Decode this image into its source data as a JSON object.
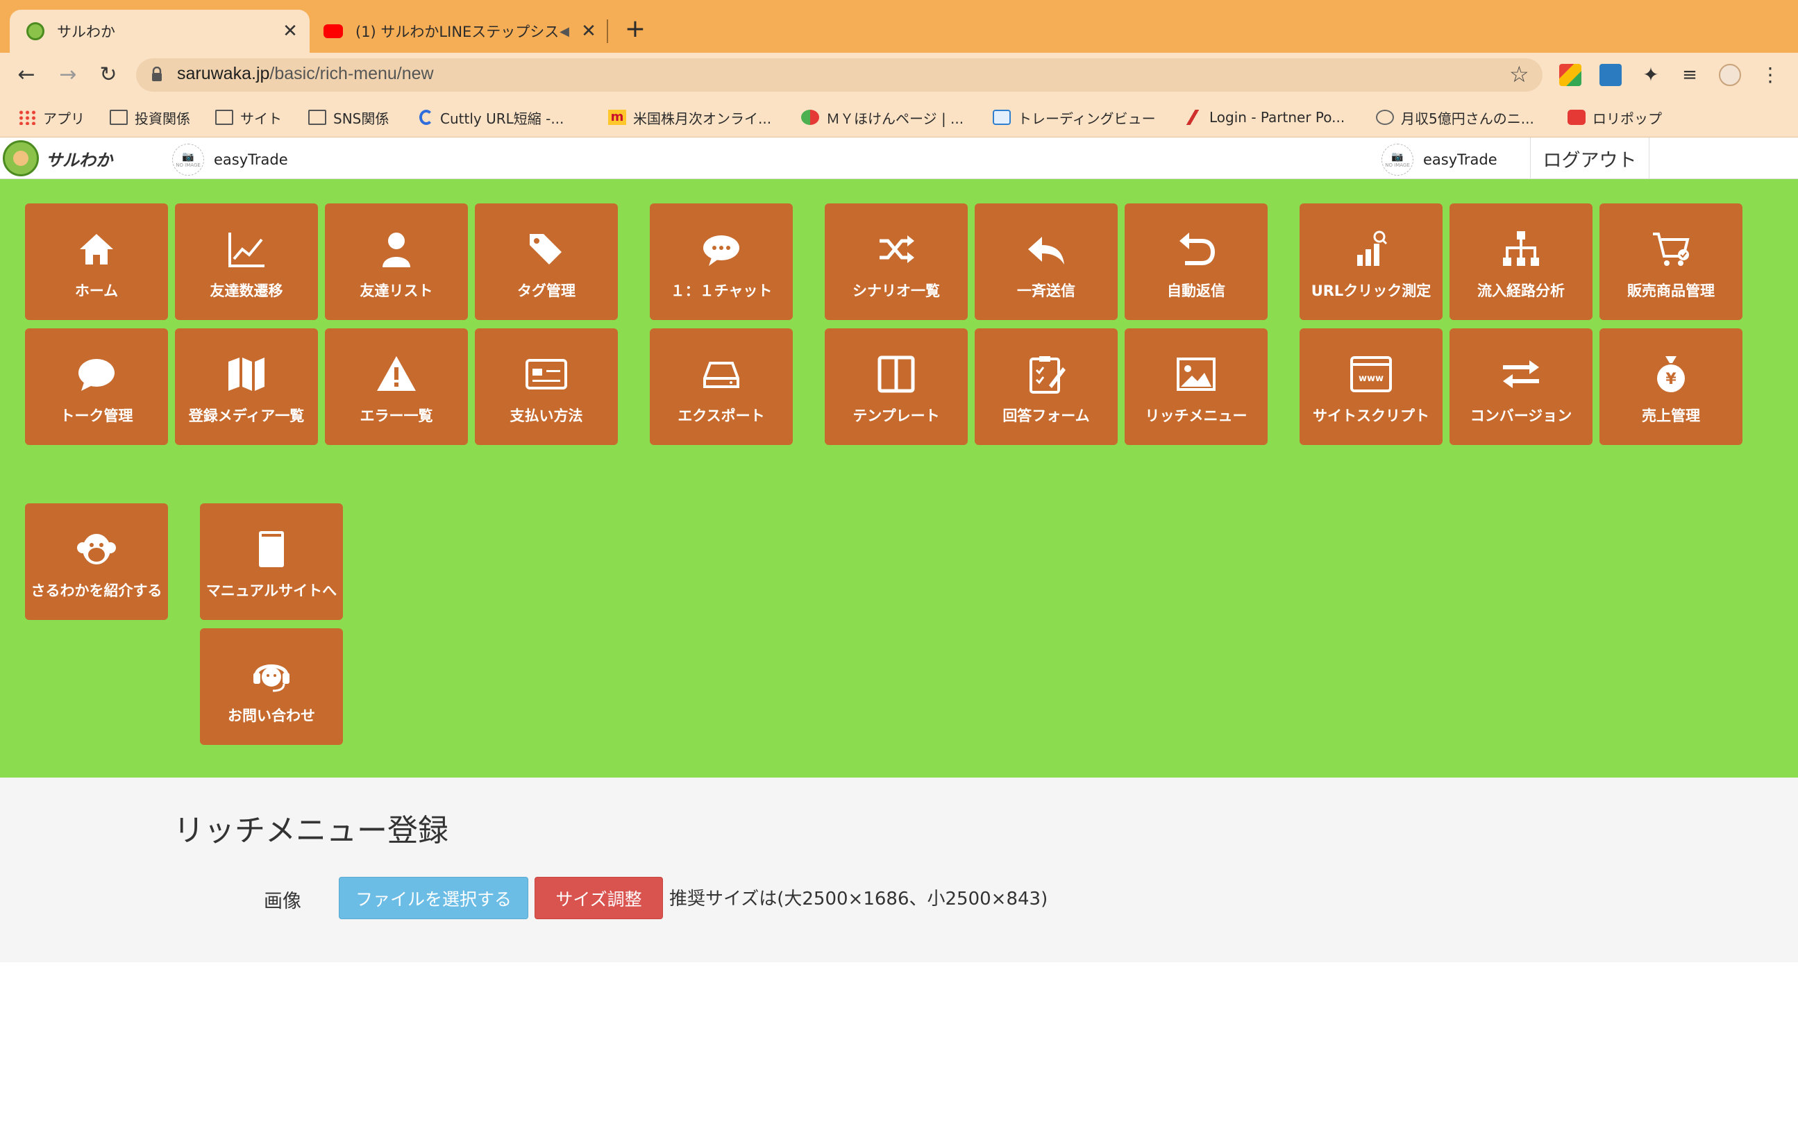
{
  "browser": {
    "tabs": [
      {
        "title": "サルわか",
        "close": "✕"
      },
      {
        "title": "(1) サルわかLINEステップシス",
        "close": "✕"
      }
    ],
    "new_tab": "+",
    "url_host": "saruwaka.jp",
    "url_path": "/basic/rich-menu/new",
    "bookmarks": [
      {
        "label": "アプリ",
        "icon": "apps-grid-icon"
      },
      {
        "label": "投資関係",
        "icon": "folder-icon"
      },
      {
        "label": "サイト",
        "icon": "folder-icon"
      },
      {
        "label": "SNS関係",
        "icon": "folder-icon"
      },
      {
        "label": "Cuttly URL短縮 -...",
        "icon": "cuttly-icon"
      },
      {
        "label": "米国株月次オンライ...",
        "icon": "mcdonalds-icon"
      },
      {
        "label": "ＭＹほけんページ | ...",
        "icon": "insurance-icon"
      },
      {
        "label": "トレーディングビュー",
        "icon": "cloud-icon"
      },
      {
        "label": "Login - Partner Po...",
        "icon": "partner-icon"
      },
      {
        "label": "月収5億円さんのニ...",
        "icon": "globe-icon"
      },
      {
        "label": "ロリポップ",
        "icon": "lolipop-icon"
      }
    ]
  },
  "header": {
    "logo_text": "サルわか",
    "account_left": "easyTrade",
    "account_right": "easyTrade",
    "no_image": "NO IMAGE",
    "logout": "ログアウト"
  },
  "menu": {
    "home": "ホーム",
    "friend_trend": "友達数遷移",
    "friend_list": "友達リスト",
    "tag_manage": "タグ管理",
    "chat": "１：１チャット",
    "scenario_list": "シナリオ一覧",
    "broadcast": "一斉送信",
    "auto_reply": "自動返信",
    "url_click": "URLクリック測定",
    "inflow_analysis": "流入経路分析",
    "product_manage": "販売商品管理",
    "talk_manage": "トーク管理",
    "media_list": "登録メディア一覧",
    "error_list": "エラー一覧",
    "payment": "支払い方法",
    "export": "エクスポート",
    "template": "テンプレート",
    "answer_form": "回答フォーム",
    "rich_menu": "リッチメニュー",
    "site_script": "サイトスクリプト",
    "conversion": "コンバージョン",
    "sales_manage": "売上管理",
    "introduce": "さるわかを紹介する",
    "manual": "マニュアルサイトへ",
    "contact": "お問い合わせ"
  },
  "form": {
    "title": "リッチメニュー登録",
    "image_label": "画像",
    "file_button": "ファイルを選択する",
    "resize_button": "サイズ調整",
    "size_hint": "推奨サイズは(大2500×1686、小2500×843)"
  },
  "colors": {
    "tabbar": "#f5ae55",
    "menu_bg": "#8cdc4f",
    "tile": "#c76a2e",
    "file_button": "#6bbde6",
    "resize_button": "#d9534f"
  }
}
